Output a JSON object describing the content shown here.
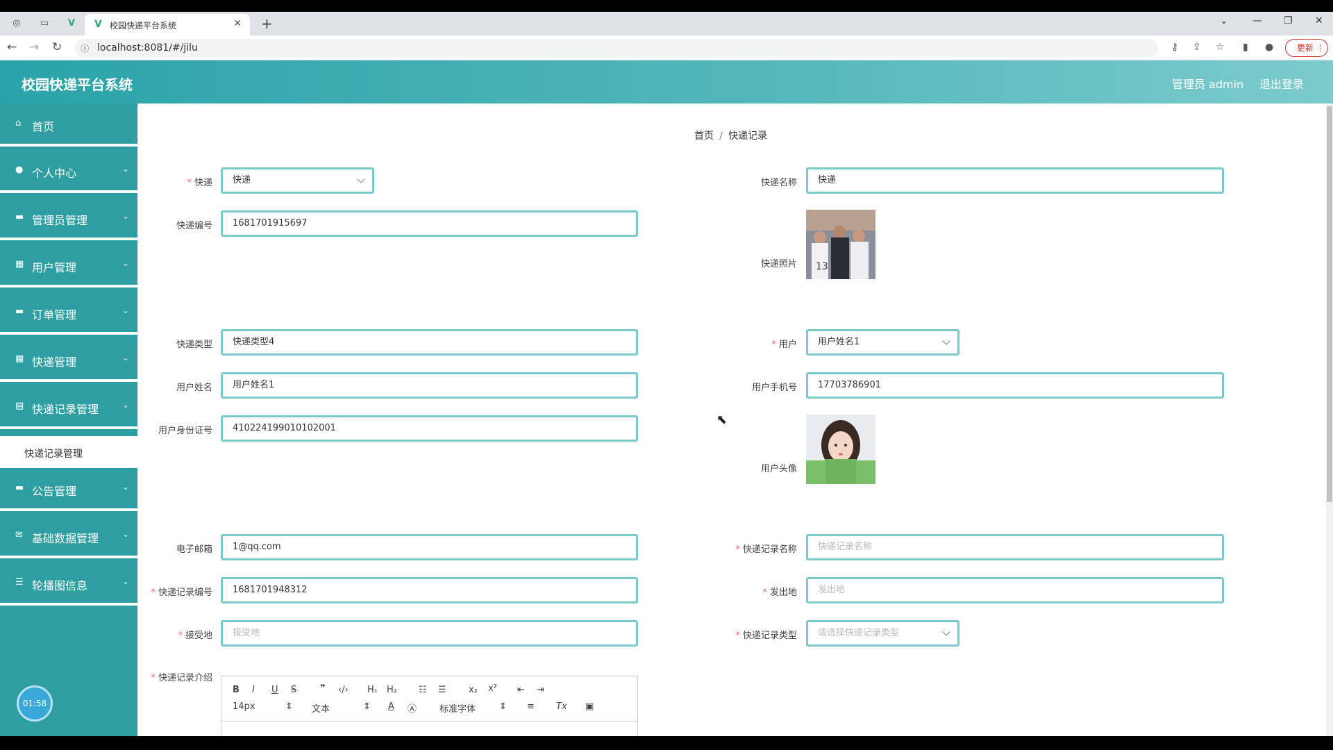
{
  "browser": {
    "tab_title": "校园快递平台系统",
    "url": "localhost:8081/#/jilu",
    "update_label": "更新"
  },
  "header": {
    "brand": "校园快递平台系统",
    "user": "管理员 admin",
    "logout": "退出登录"
  },
  "sidebar": {
    "items": [
      {
        "label": "首页",
        "icon": "home-icon"
      },
      {
        "label": "个人中心",
        "icon": "user-icon"
      },
      {
        "label": "管理员管理",
        "icon": "chat-icon"
      },
      {
        "label": "用户管理",
        "icon": "grid-icon"
      },
      {
        "label": "订单管理",
        "icon": "briefcase-icon"
      },
      {
        "label": "快递管理",
        "icon": "grid-icon"
      },
      {
        "label": "快递记录管理",
        "icon": "document-icon"
      },
      {
        "label": "公告管理",
        "icon": "chat-icon"
      },
      {
        "label": "基础数据管理",
        "icon": "mail-icon"
      },
      {
        "label": "轮播图信息",
        "icon": "sliders-icon"
      }
    ],
    "submenu": "快递记录管理",
    "timer": "01:58"
  },
  "breadcrumb": {
    "home": "首页",
    "separator": "/",
    "current": "快递记录"
  },
  "form": {
    "kuaidi_label": "快递",
    "kuaidi_value": "快递",
    "kuaidi_name_label": "快递名称",
    "kuaidi_name_value": "快递",
    "kuaidi_no_label": "快递编号",
    "kuaidi_no_value": "1681701915697",
    "kuaidi_photo_label": "快递照片",
    "kuaidi_type_label": "快递类型",
    "kuaidi_type_value": "快递类型4",
    "yonghu_label": "用户",
    "yonghu_value": "用户姓名1",
    "user_name_label": "用户姓名",
    "user_name_value": "用户姓名1",
    "user_phone_label": "用户手机号",
    "user_phone_value": "17703786901",
    "id_card_label": "用户身份证号",
    "id_card_value": "410224199010102001",
    "avatar_label": "用户头像",
    "email_label": "电子邮箱",
    "email_value": "1@qq.com",
    "record_name_label": "快递记录名称",
    "record_name_placeholder": "快递记录名称",
    "record_no_label": "快递记录编号",
    "record_no_value": "1681701948312",
    "origin_label": "发出地",
    "origin_placeholder": "发出地",
    "dest_label": "接受地",
    "dest_placeholder": "接受地",
    "record_type_label": "快递记录类型",
    "record_type_placeholder": "请选择快递记录类型",
    "intro_label": "快递记录介绍",
    "required_mark": "*"
  },
  "editor": {
    "font_size": "14px",
    "block": "文本",
    "font": "标准字体"
  }
}
